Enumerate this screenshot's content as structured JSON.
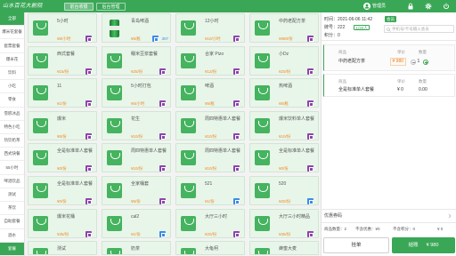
{
  "app": {
    "brand": "山水百花大剧院"
  },
  "topbar": {
    "tabs": [
      {
        "label": "前台收银",
        "active": true
      },
      {
        "label": "后台管理",
        "active": false
      }
    ],
    "user": "管理员",
    "icons": [
      "avatar-icon",
      "lock-icon",
      "settings-icon",
      "power-icon"
    ]
  },
  "sidebar": {
    "items": [
      {
        "label": "全部",
        "active": true
      },
      {
        "label": "爆米花套餐"
      },
      {
        "label": "套票套餐"
      },
      {
        "label": "爆米花"
      },
      {
        "label": "饮料"
      },
      {
        "label": "小吃"
      },
      {
        "label": "零食"
      },
      {
        "label": "雪糕冰品"
      },
      {
        "label": "特色小吃"
      },
      {
        "label": "热饮奶茶"
      },
      {
        "label": "西式快餐"
      },
      {
        "label": "55小时"
      },
      {
        "label": "啤酒饮品"
      },
      {
        "label": "测试"
      },
      {
        "label": "茶饮"
      },
      {
        "label": "自助套餐"
      },
      {
        "label": "酒水"
      },
      {
        "label": "套餐",
        "active": true
      }
    ]
  },
  "products": [
    {
      "name": "5小时",
      "price": "¥8/小时",
      "badge": "#8e44ad",
      "icon": "shopping-bag-icon"
    },
    {
      "name": "青岛啤酒",
      "price": "¥5/瓶",
      "badge": "#3b8beb",
      "stock": "307",
      "icon": "beer-can-icon"
    },
    {
      "name": "12小时",
      "price": "¥10/小时",
      "badge": "#8e44ad",
      "icon": "shopping-bag-icon"
    },
    {
      "name": "中药老配方茶",
      "price": "¥980/份",
      "badge": "#8e44ad",
      "icon": "shopping-bag-icon"
    },
    {
      "name": "西式套餐",
      "price": "¥15/份",
      "badge": "#8e44ad",
      "icon": "shopping-bag-icon"
    },
    {
      "name": "糯米豆浆套餐",
      "price": "¥25/份",
      "badge": "#8e44ad",
      "icon": "shopping-bag-icon"
    },
    {
      "name": "合家 Pizo",
      "price": "¥13/份",
      "badge": "#8e44ad",
      "icon": "shopping-bag-icon"
    },
    {
      "name": "小Dz",
      "price": "¥20/份",
      "badge": "#8e44ad",
      "icon": "shopping-bag-icon"
    },
    {
      "name": "11",
      "price": "¥1/份",
      "badge": "#8e44ad",
      "icon": "shopping-bag-icon"
    },
    {
      "name": "5小时打包",
      "price": "¥5/小时",
      "badge": "#8e44ad",
      "icon": "shopping-bag-icon"
    },
    {
      "name": "啤酒",
      "price": "¥5/瓶",
      "badge": "#8e44ad",
      "icon": "shopping-bag-icon"
    },
    {
      "name": "热啤酒",
      "price": "¥5/瓶",
      "badge": "#8e44ad",
      "icon": "shopping-bag-icon"
    },
    {
      "name": "爆米",
      "price": "¥5/份",
      "badge": "#8e44ad",
      "icon": "shopping-bag-icon"
    },
    {
      "name": "花生",
      "price": "¥10/份",
      "badge": "#8e44ad",
      "icon": "shopping-bag-icon"
    },
    {
      "name": "周四特惠单人套餐",
      "price": "¥10/份",
      "badge": "#8e44ad",
      "icon": "shopping-bag-icon"
    },
    {
      "name": "爆米饮料单人套餐",
      "price": "¥10/份",
      "badge": "#8e44ad",
      "icon": "shopping-bag-icon"
    },
    {
      "name": "全是标准单人套餐",
      "price": "¥0/份",
      "badge": "#8e44ad",
      "icon": "shopping-bag-icon"
    },
    {
      "name": "周四特惠单人套餐",
      "price": "¥10/份",
      "badge": "#8e44ad",
      "icon": "shopping-bag-icon"
    },
    {
      "name": "周四特惠单人套餐",
      "price": "¥10/份",
      "badge": "#8e44ad",
      "icon": "shopping-bag-icon"
    },
    {
      "name": "全是标准单人套餐",
      "price": "¥0/份",
      "badge": "#8e44ad",
      "icon": "shopping-bag-icon"
    },
    {
      "name": "全是标准单人套餐",
      "price": "¥0/份",
      "badge": "#8e44ad",
      "icon": "shopping-bag-icon"
    },
    {
      "name": "全家桶套",
      "price": "¥5/份",
      "badge": "#8e44ad",
      "icon": "shopping-bag-icon"
    },
    {
      "name": "521",
      "price": "¥1/份",
      "badge": "#3b8beb",
      "icon": "shopping-bag-icon"
    },
    {
      "name": "520",
      "price": "¥20/份",
      "badge": "#3b8beb",
      "icon": "shopping-bag-icon"
    },
    {
      "name": "爆米花桶",
      "price": "¥35/份",
      "badge": "#8e44ad",
      "icon": "shopping-bag-icon"
    },
    {
      "name": "cal2",
      "price": "¥1/份",
      "badge": "#3b8beb",
      "icon": "shopping-bag-icon"
    },
    {
      "name": "大厅三小时",
      "price": "¥20/份",
      "badge": "#8e44ad",
      "icon": "shopping-bag-icon"
    },
    {
      "name": "大厅三小时精品",
      "price": "¥35/份",
      "badge": "#8e44ad",
      "icon": "shopping-bag-icon"
    },
    {
      "name": "测试",
      "icon": "shopping-bag-icon"
    },
    {
      "name": "奶茶",
      "icon": "shopping-bag-icon"
    },
    {
      "name": "大龟柯",
      "icon": "shopping-bag-icon"
    },
    {
      "name": "蜂蜜大麦",
      "icon": "shopping-bag-icon"
    }
  ],
  "order": {
    "time_label": "时间：",
    "time": "2021-06-06 11:42",
    "member_button": "会员",
    "table_label": "牌号：",
    "table": "222",
    "guests": "1/20人",
    "points_label": "积分：",
    "points": "0",
    "member_search_placeholder": "手机号/卡号输入会员",
    "headers": {
      "item": "商品",
      "price": "单价",
      "qty": "数量"
    },
    "items": [
      {
        "name": "中药老配方茶",
        "price": "¥ 980",
        "qty": "1"
      },
      {
        "name": "全是标准单人套餐",
        "price": "¥ 0",
        "qty": "0.00"
      }
    ],
    "coupon_label": "优惠券码",
    "summary": [
      "商品数量：2",
      "不含优惠：¥0",
      "不含积分：0",
      "¥ 0"
    ],
    "hold_button": "挂单",
    "checkout_button": "结账",
    "checkout_amount": "¥ 980"
  },
  "colors": {
    "primary": "#3aa757",
    "price": "#f08a24",
    "badge_purple": "#8e44ad",
    "badge_blue": "#3b8beb",
    "card_bg": "#e8f5e9"
  }
}
